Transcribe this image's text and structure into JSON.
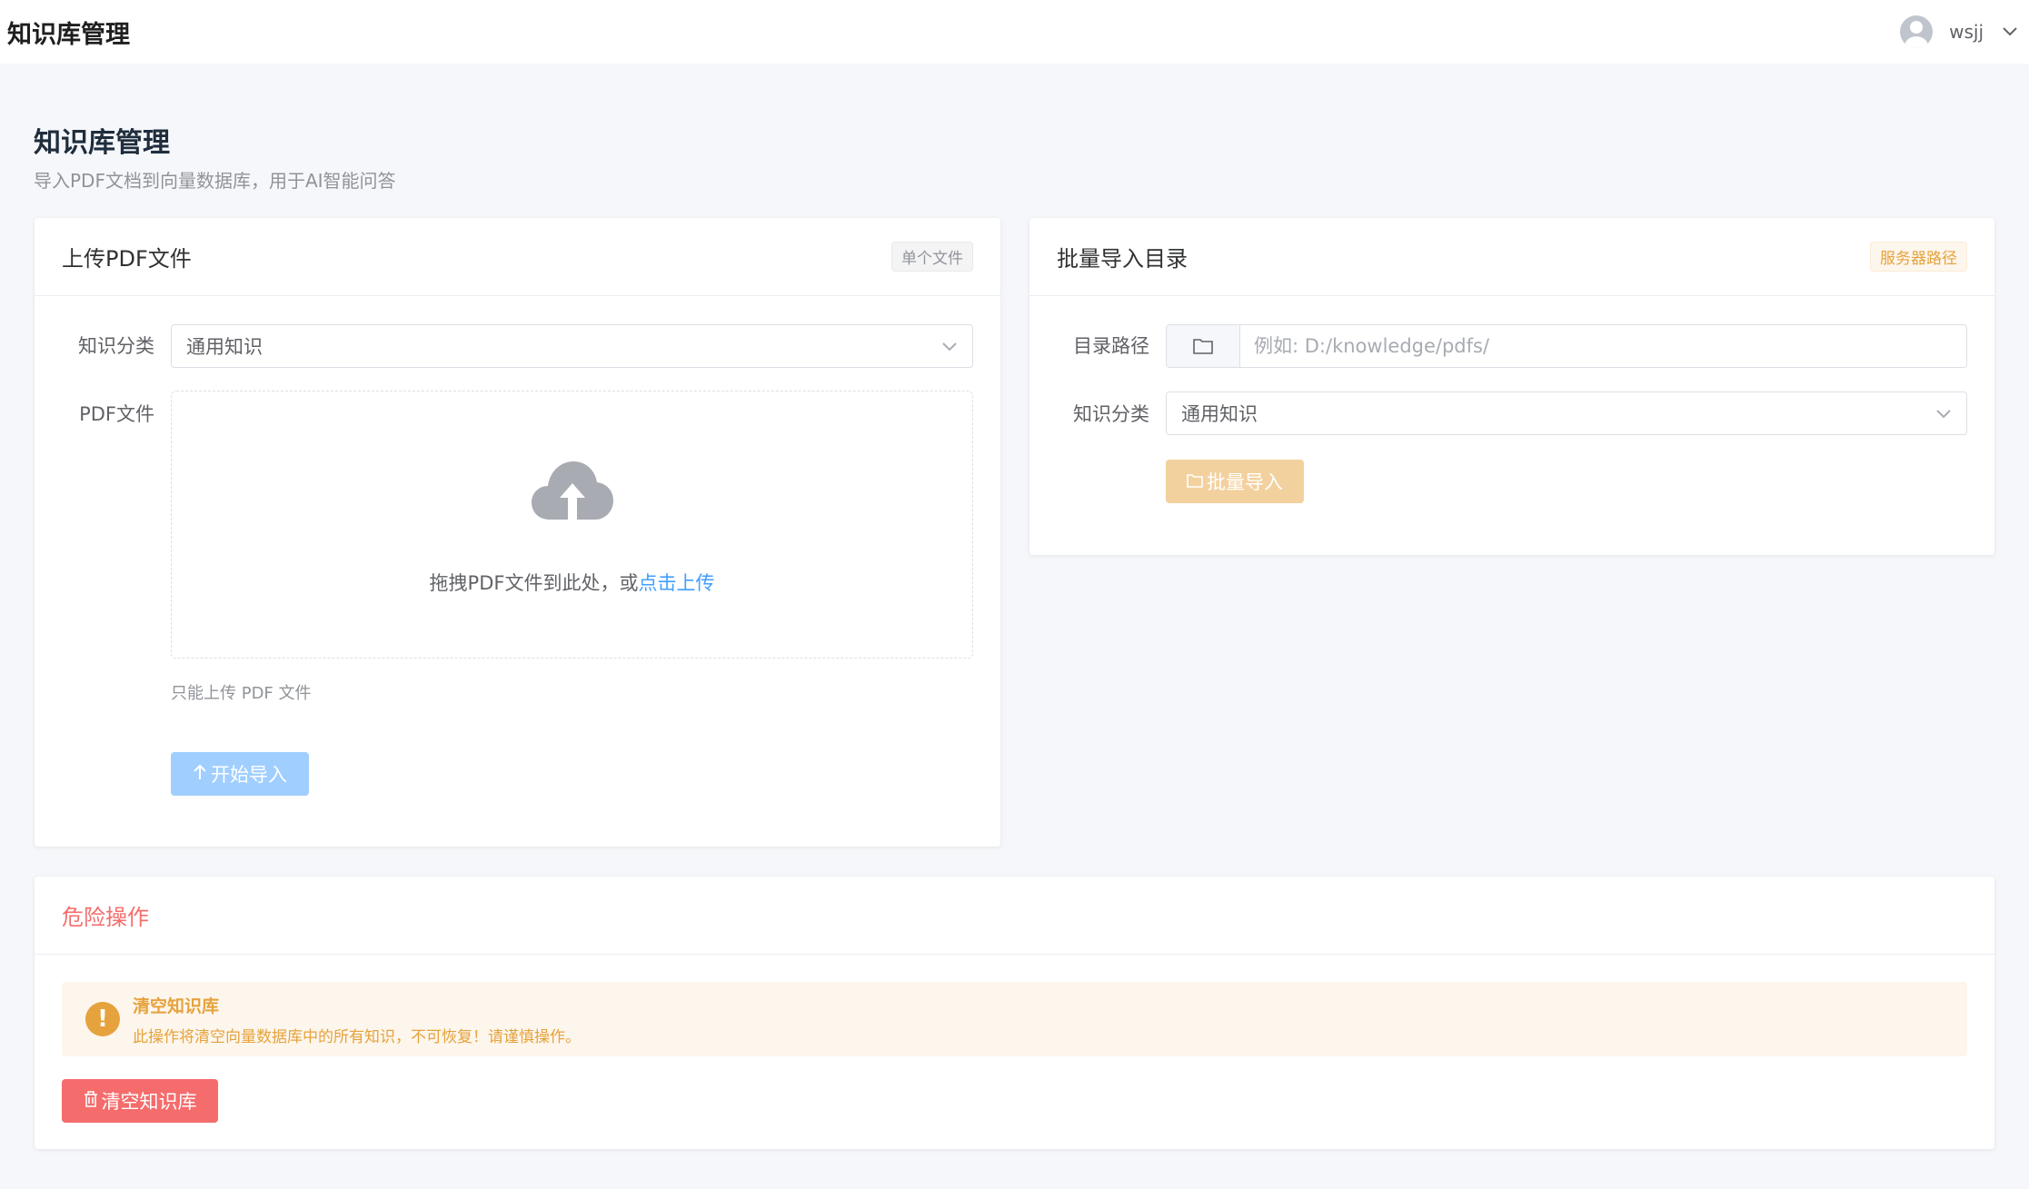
{
  "header": {
    "app_title": "知识库管理",
    "username": "wsjj"
  },
  "page": {
    "title": "知识库管理",
    "subtitle": "导入PDF文档到向量数据库，用于AI智能问答"
  },
  "upload_card": {
    "title": "上传PDF文件",
    "tag": "单个文件",
    "category_label": "知识分类",
    "category_value": "通用知识",
    "file_label": "PDF文件",
    "drop_text": "拖拽PDF文件到此处，或",
    "drop_link": "点击上传",
    "hint": "只能上传 PDF 文件",
    "submit_label": "开始导入"
  },
  "batch_card": {
    "title": "批量导入目录",
    "tag": "服务器路径",
    "path_label": "目录路径",
    "path_placeholder": "例如: D:/knowledge/pdfs/",
    "category_label": "知识分类",
    "category_value": "通用知识",
    "submit_label": "批量导入"
  },
  "danger_card": {
    "title": "危险操作",
    "alert_title": "清空知识库",
    "alert_desc": "此操作将清空向量数据库中的所有知识，不可恢复！请谨慎操作。",
    "clear_label": "清空知识库"
  },
  "colors": {
    "primary": "#409eff",
    "warning": "#e6a23c",
    "danger": "#f56c6c",
    "background": "#f5f7fa"
  },
  "icons": [
    "user-avatar-icon",
    "chevron-down-icon",
    "upload-cloud-icon",
    "upload-arrow-icon",
    "folder-icon",
    "folder-open-icon",
    "warning-icon",
    "trash-icon"
  ]
}
